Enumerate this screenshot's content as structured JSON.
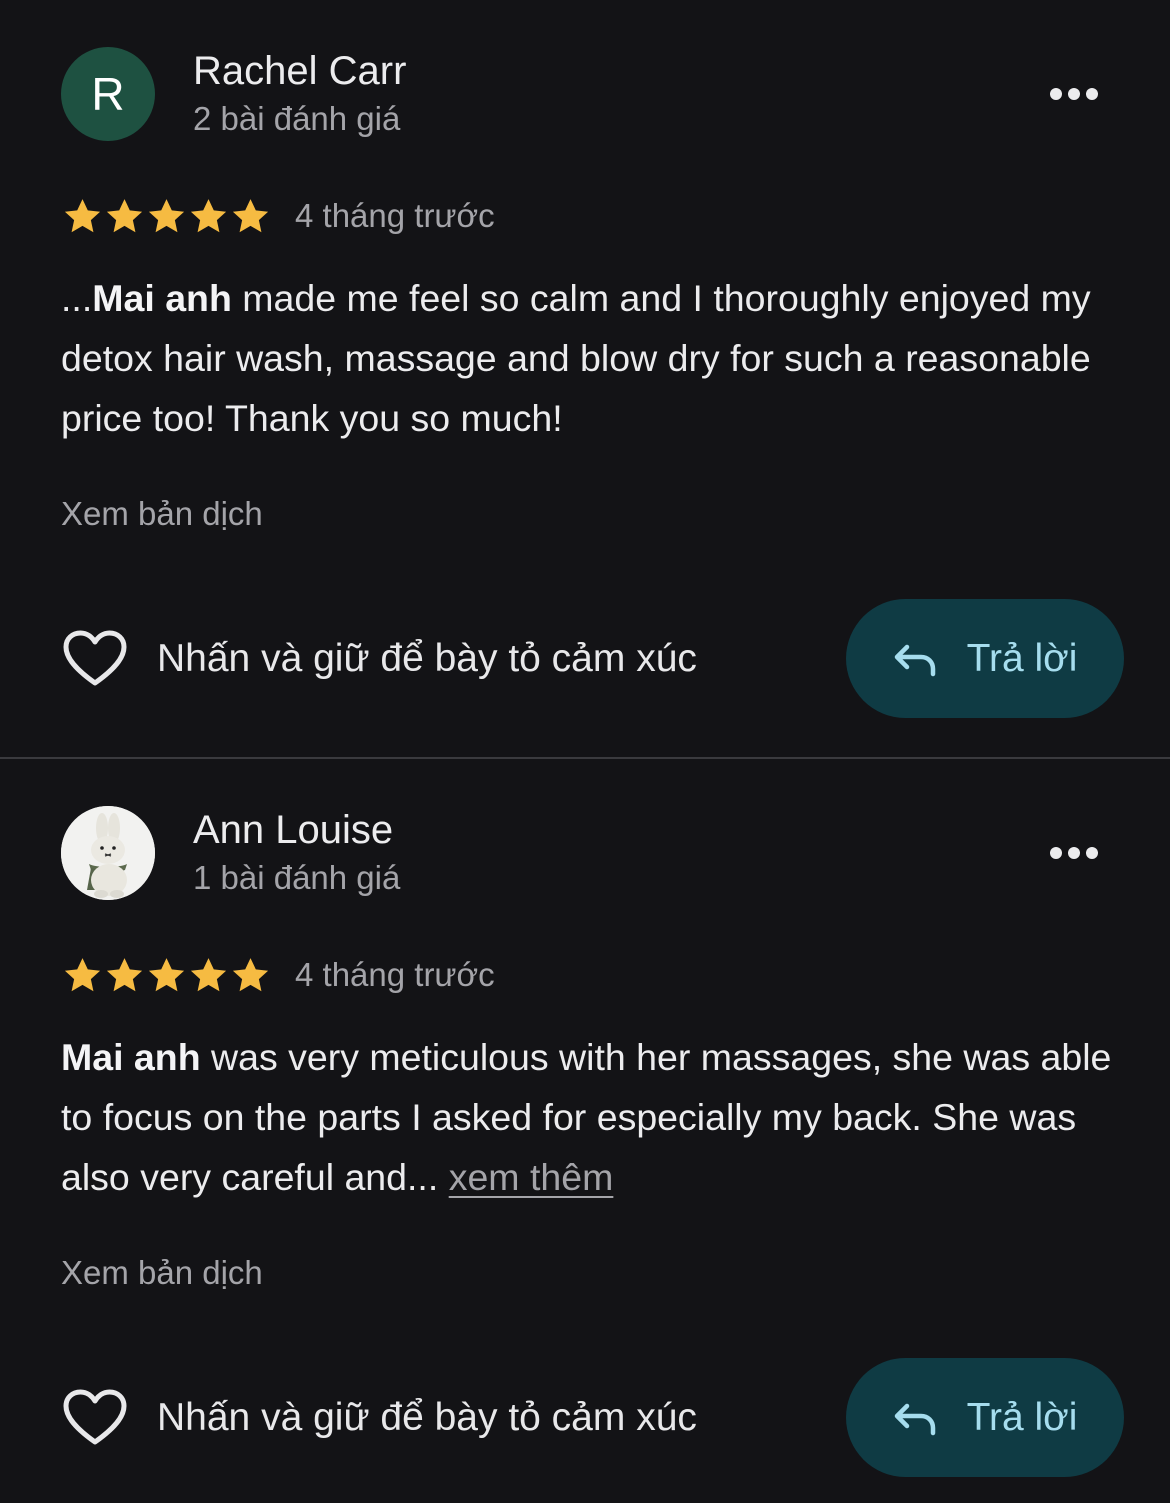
{
  "reviews": [
    {
      "author": {
        "avatar_letter": "R",
        "avatar_color": "#1e5141",
        "name": "Rachel Carr",
        "review_count": "2 bài đánh giá"
      },
      "rating": 5,
      "max_rating": 5,
      "time_ago": "4 tháng trước",
      "text_prefix": "...",
      "text_bold": "Mai anh",
      "text_body": " made me feel so calm and I thoroughly enjoyed my detox hair wash, massage and blow dry for such a reasonable price too! Thank you so much!",
      "see_more": "",
      "translate_label": "Xem bản dịch",
      "react_label": "Nhấn và giữ để bày tỏ cảm xúc",
      "reply_label": "Trả lời"
    },
    {
      "author": {
        "avatar_icon": "bunny-plush-photo",
        "name": "Ann Louise",
        "review_count": "1 bài đánh giá"
      },
      "rating": 5,
      "max_rating": 5,
      "time_ago": "4 tháng trước",
      "text_prefix": "",
      "text_bold": "Mai anh",
      "text_body": " was very meticulous with her massages, she was able to focus on the parts I asked for especially my back. She was also very careful and... ",
      "see_more": "xem thêm",
      "translate_label": "Xem bản dịch",
      "react_label": "Nhấn và giữ để bày tỏ cảm xúc",
      "reply_label": "Trả lời"
    }
  ],
  "icons": {
    "more": "more-horizontal-icon",
    "star": "star-icon",
    "heart": "heart-outline-icon",
    "reply": "reply-arrow-icon"
  },
  "colors": {
    "background": "#131316",
    "star": "#f6bb42",
    "reply_button": "#0f3b44",
    "reply_text": "#a6ddee",
    "secondary_text": "#a4a4a9"
  }
}
